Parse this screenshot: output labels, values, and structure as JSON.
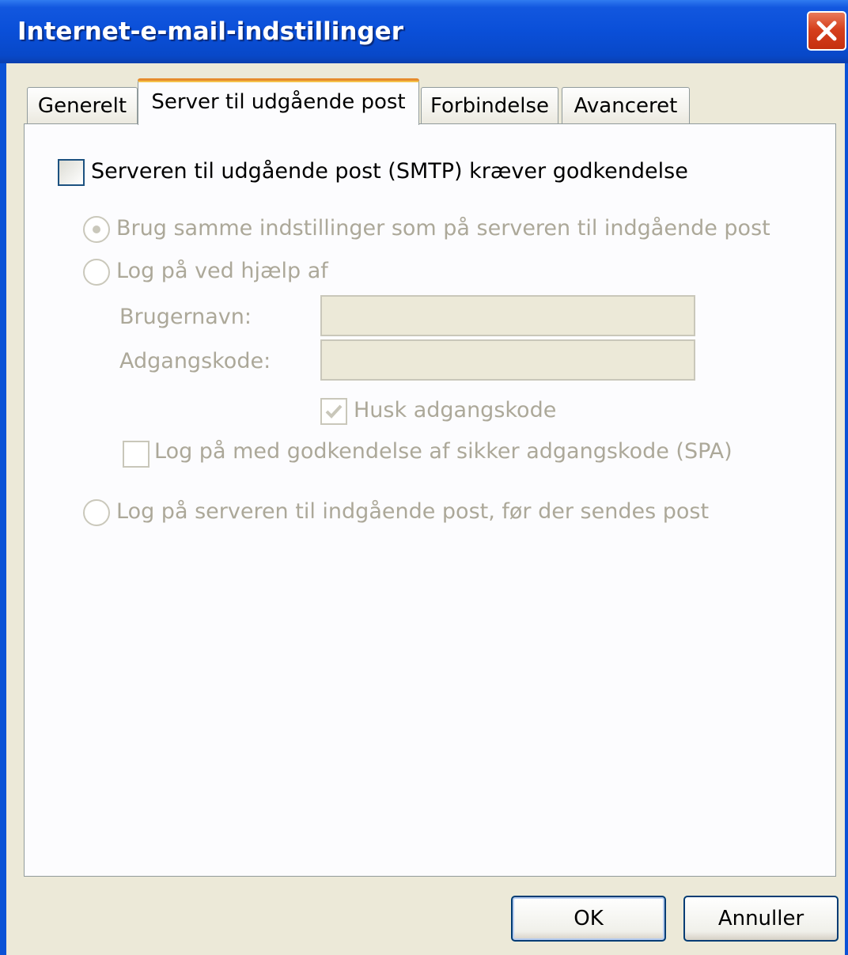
{
  "window": {
    "title": "Internet-e-mail-indstillinger"
  },
  "tabs": [
    {
      "label": "Generelt",
      "active": false
    },
    {
      "label": "Server til udgående post",
      "active": true
    },
    {
      "label": "Forbindelse",
      "active": false
    },
    {
      "label": "Avanceret",
      "active": false
    }
  ],
  "smtp_auth": {
    "label": "Serveren til udgående post (SMTP) kræver godkendelse",
    "checked": false
  },
  "options": {
    "same_settings": {
      "label": "Brug samme indstillinger som på serveren til indgående post",
      "selected": true
    },
    "log_on_using": {
      "label": "Log på ved hjælp af",
      "selected": false
    },
    "log_on_incoming_first": {
      "label": "Log på serveren til indgående post, før der sendes post",
      "selected": false
    }
  },
  "credentials": {
    "username_label": "Brugernavn:",
    "username_value": "",
    "password_label": "Adgangskode:",
    "password_value": "",
    "remember_label": "Husk adgangskode",
    "remember_checked": true,
    "spa_label": "Log på med godkendelse af sikker adgangskode (SPA)",
    "spa_checked": false
  },
  "buttons": {
    "ok": "OK",
    "cancel": "Annuller"
  },
  "colors": {
    "title_bar": "#0a52d6",
    "dialog_face": "#ece9d8",
    "disabled_text": "#aca899",
    "active_tab_highlight": "#e68b2c"
  }
}
